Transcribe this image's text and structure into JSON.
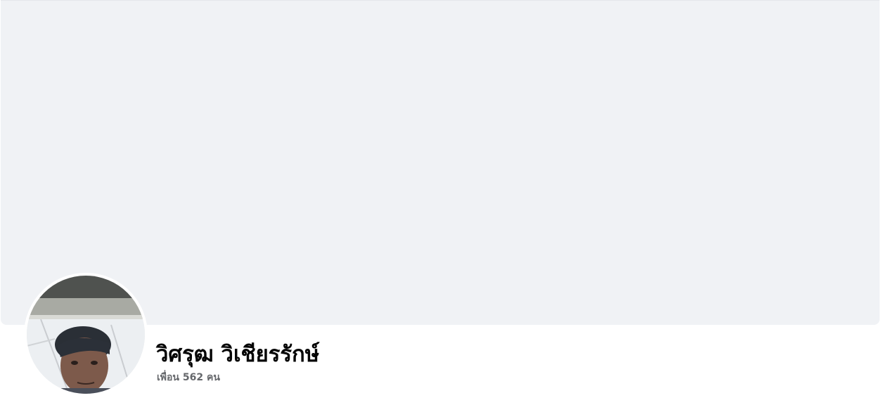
{
  "profile": {
    "name": "วิศรุฒ วิเชียรรักษ์",
    "friends_text": "เพื่อน 562 คน"
  },
  "colors": {
    "cover_background": "#f0f2f5",
    "name_text": "#050505",
    "secondary_text": "#65676b",
    "avatar_border": "#ffffff"
  }
}
